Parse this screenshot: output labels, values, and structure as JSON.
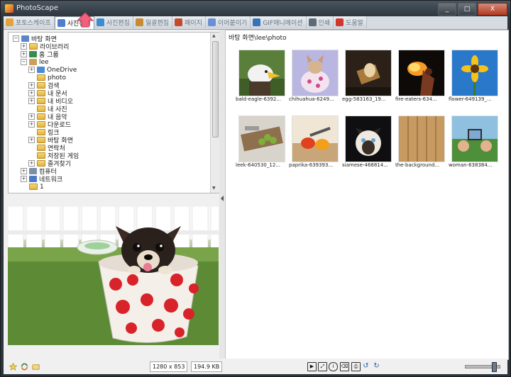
{
  "window": {
    "title": "PhotoScape",
    "minimize": "_",
    "maximize": "□",
    "close": "X"
  },
  "tabs": [
    {
      "label": "포토스케이프",
      "active": false,
      "color": "#e3a33a"
    },
    {
      "label": "사진뷰어",
      "active": true,
      "color": "#4f7ecb"
    },
    {
      "label": "사진편집",
      "active": false,
      "color": "#3b8dd0"
    },
    {
      "label": "일괄편집",
      "active": false,
      "color": "#c98b2f"
    },
    {
      "label": "페이지",
      "active": false,
      "color": "#c44a2e"
    },
    {
      "label": "이어붙이기",
      "active": false,
      "color": "#6b8fd6"
    },
    {
      "label": "GIF애니메이션",
      "active": false,
      "color": "#3a72b8"
    },
    {
      "label": "인쇄",
      "active": false,
      "color": "#5d6b78"
    },
    {
      "label": "도움말",
      "active": false,
      "color": "#d0362a"
    }
  ],
  "tree": [
    {
      "label": "바탕 화면",
      "depth": 0,
      "exp": "⊟",
      "ico": "desktop"
    },
    {
      "label": "라이브러리",
      "depth": 1,
      "exp": "⊞",
      "ico": "folder"
    },
    {
      "label": "홈 그룹",
      "depth": 1,
      "exp": "⊞",
      "ico": "home"
    },
    {
      "label": "lee",
      "depth": 1,
      "exp": "⊟",
      "ico": "user"
    },
    {
      "label": "OneDrive",
      "depth": 2,
      "exp": "⊞",
      "ico": "cloud"
    },
    {
      "label": "photo",
      "depth": 2,
      "exp": "",
      "ico": "folder"
    },
    {
      "label": "검색",
      "depth": 2,
      "exp": "⊞",
      "ico": "folder"
    },
    {
      "label": "내 문서",
      "depth": 2,
      "exp": "⊞",
      "ico": "folder"
    },
    {
      "label": "내 비디오",
      "depth": 2,
      "exp": "⊞",
      "ico": "folder"
    },
    {
      "label": "내 사진",
      "depth": 2,
      "exp": "",
      "ico": "folder"
    },
    {
      "label": "내 음악",
      "depth": 2,
      "exp": "⊞",
      "ico": "folder"
    },
    {
      "label": "다운로드",
      "depth": 2,
      "exp": "⊞",
      "ico": "folder"
    },
    {
      "label": "링크",
      "depth": 2,
      "exp": "",
      "ico": "folder"
    },
    {
      "label": "바탕 화면",
      "depth": 2,
      "exp": "⊞",
      "ico": "folder"
    },
    {
      "label": "연락처",
      "depth": 2,
      "exp": "",
      "ico": "folder"
    },
    {
      "label": "저장된 게임",
      "depth": 2,
      "exp": "",
      "ico": "folder"
    },
    {
      "label": "즐겨찾기",
      "depth": 2,
      "exp": "⊞",
      "ico": "folder"
    },
    {
      "label": "컴퓨터",
      "depth": 1,
      "exp": "⊞",
      "ico": "computer"
    },
    {
      "label": "네트워크",
      "depth": 1,
      "exp": "⊞",
      "ico": "network"
    },
    {
      "label": "1",
      "depth": 1,
      "exp": "",
      "ico": "folder"
    }
  ],
  "browser": {
    "path": "바탕 화면\\lee\\photo",
    "thumbnails": [
      {
        "caption": "bald-eagle-6392...",
        "art": "eagle"
      },
      {
        "caption": "chihuahua-6249...",
        "art": "chihuahua"
      },
      {
        "caption": "egg-583163_19...",
        "art": "egg"
      },
      {
        "caption": "fire-eaters-634...",
        "art": "fire"
      },
      {
        "caption": "flower-649139_...",
        "art": "flower"
      },
      {
        "caption": "leek-640530_12...",
        "art": "leek"
      },
      {
        "caption": "paprika-639393...",
        "art": "paprika"
      },
      {
        "caption": "siamese-468814...",
        "art": "siamese"
      },
      {
        "caption": "the-background...",
        "art": "wood"
      },
      {
        "caption": "woman-638384...",
        "art": "woman"
      }
    ]
  },
  "status": {
    "dimensions": "1280 x 853",
    "filesize": "194.9 KB",
    "zoom_fraction": 0.85
  }
}
